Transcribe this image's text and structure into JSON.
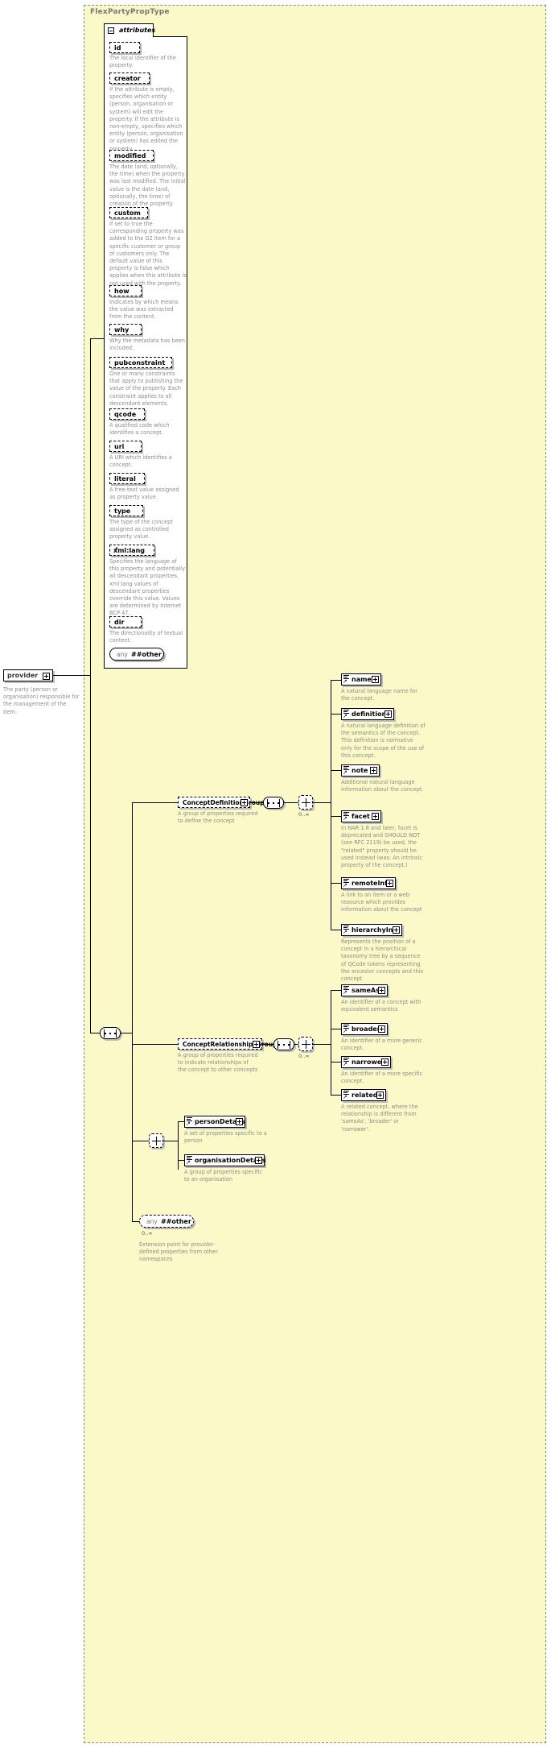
{
  "type": {
    "title": "FlexPartyPropType"
  },
  "attributes": {
    "tab_label": "attributes",
    "items": [
      {
        "name": "id",
        "doc": "The local identifier of the property."
      },
      {
        "name": "creator",
        "doc": "If the attribute is empty, specifies which entity (person, organisation or system) will edit the property. If the attribute is non-empty, specifies which entity (person, organisation or system) has edited the property."
      },
      {
        "name": "modified",
        "doc": "The date (and, optionally, the time) when the property was last modified. The initial value is the date (and, optionally, the time) of creation of the property."
      },
      {
        "name": "custom",
        "doc": "If set to true the corresponding property was added to the G2 Item for a specific customer or group of customers only. The default value of this property is false which applies when this attribute is not used with the property."
      },
      {
        "name": "how",
        "doc": "Indicates by which means the value was extracted from the content."
      },
      {
        "name": "why",
        "doc": "Why the metadata has been included."
      },
      {
        "name": "pubconstraint",
        "doc": "One or many constraints that apply to publishing the value of the property. Each constraint applies to all descendant elements."
      },
      {
        "name": "qcode",
        "doc": "A qualified code which identifies a concept."
      },
      {
        "name": "uri",
        "doc": "A URI which identifies a concept."
      },
      {
        "name": "literal",
        "doc": "A free-text value assigned as property value."
      },
      {
        "name": "type",
        "doc": "The type of the concept assigned as controlled property value."
      },
      {
        "name": "xml:lang",
        "doc": "Specifies the language of this property and potentially all descendant properties. xml:lang values of descendant properties override this value. Values are determined by Internet BCP 47."
      },
      {
        "name": "dir",
        "doc": "The directionality of textual content."
      }
    ],
    "any": {
      "prefix": "any",
      "namespace": "##other"
    }
  },
  "root": {
    "name": "provider",
    "doc": "The party (person or organisation) responsible for the management of the Item."
  },
  "groups": [
    {
      "id": "conceptDefinitionGroup",
      "name": "ConceptDefinitionGroup",
      "doc": "A group of properties required to define the concept",
      "cardinality": "0..∞",
      "elements": [
        {
          "name": "name",
          "doc": "A natural language name for the concept."
        },
        {
          "name": "definition",
          "doc": "A natural language definition of the semantics of the concept. This definition is normative only for the scope of the use of this concept."
        },
        {
          "name": "note",
          "doc": "Additional natural language information about the concept."
        },
        {
          "name": "facet",
          "doc": "In NAR 1.8 and later, facet is deprecated and SHOULD NOT (see RFC 2119) be used, the \"related\" property should be used instead (was: An intrinsic property of the concept.)"
        },
        {
          "name": "remoteInfo",
          "doc": "A link to an item or a web resource which provides information about the concept"
        },
        {
          "name": "hierarchyInfo",
          "doc": "Represents the position of a concept in a hierarchical taxonomy tree by a sequence of QCode tokens representing the ancestor concepts and this concept"
        }
      ]
    },
    {
      "id": "conceptRelationshipsGroup",
      "name": "ConceptRelationshipsGroup",
      "doc": "A group of properties required to indicate relationships of the concept to other concepts",
      "cardinality": "0..∞",
      "elements": [
        {
          "name": "sameAs",
          "doc": "An identifier of a concept with equivalent semantics"
        },
        {
          "name": "broader",
          "doc": "An identifier of a more generic concept."
        },
        {
          "name": "narrower",
          "doc": "An identifier of a more specific concept."
        },
        {
          "name": "related",
          "doc": "A related concept, where the relationship is different from 'sameAs', 'broader' or 'narrower'."
        }
      ]
    }
  ],
  "details": {
    "elements": [
      {
        "name": "personDetails",
        "doc": "A set of properties specific to a person"
      },
      {
        "name": "organisationDetails",
        "doc": "A group of properties specific to an organisation"
      }
    ]
  },
  "extension": {
    "any": {
      "prefix": "any",
      "namespace": "##other"
    },
    "cardinality": "0..∞",
    "doc": "Extension point for provider-defined properties from other namespaces"
  },
  "colors": {
    "type_background": "#fbf9c8",
    "node_background": "#ffffff",
    "border": "#000000",
    "doc_text": "#8d8d8d",
    "title_text": "#777777",
    "shadow": "#bdbdbd"
  }
}
